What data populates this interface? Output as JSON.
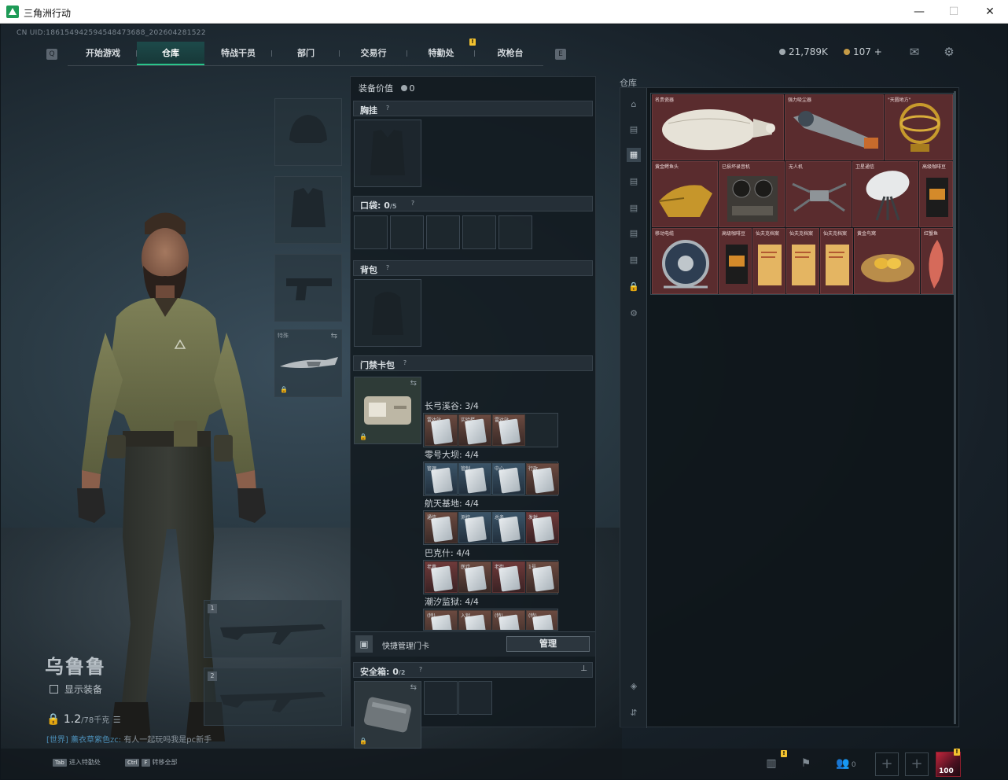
{
  "window": {
    "title": "三角洲行动",
    "minimize": "—",
    "maximize": "☐",
    "close": "✕"
  },
  "account": {
    "cnuid": "CN UID:18615494259454847368​8_202604281522"
  },
  "nav": {
    "left_key": "Q",
    "right_key": "E",
    "tabs": [
      {
        "label": "开始游戏"
      },
      {
        "label": "仓库"
      },
      {
        "label": "特战干员"
      },
      {
        "label": "部门"
      },
      {
        "label": "交易行"
      },
      {
        "label": "特勤处"
      },
      {
        "label": "改枪台"
      }
    ],
    "badge": "!"
  },
  "currency": {
    "silver": "21,789K",
    "gold": "107",
    "add": "+"
  },
  "character": {
    "name": "乌鲁鲁",
    "show_equipment": "显示装备",
    "weight": "1.2",
    "weight_max": "/78千克"
  },
  "chat": {
    "channel": "[世界]",
    "user": "薰衣草紫色zc:",
    "message": "有人一起玩吗我是pc新手"
  },
  "equipment": {
    "melee_label": "特殊",
    "slot1": "1",
    "slot2": "2"
  },
  "loadout": {
    "value_label": "装备价值",
    "value": "0",
    "chest_rig": "胸挂",
    "pockets": "口袋:",
    "pockets_count": "0",
    "pockets_cap": "/5",
    "backpack": "背包",
    "keycard_case": "门禁卡包",
    "maps": [
      {
        "name": "长弓溪谷: 3/4",
        "cards": [
          "雷达站",
          "实验楼",
          "雷达站"
        ],
        "style": "brown"
      },
      {
        "name": "零号大坝: 4/4",
        "cards": [
          "管理",
          "管制",
          "中心",
          "行政"
        ],
        "style": "mixed"
      },
      {
        "name": "航天基地: 4/4",
        "cards": [
          "通信",
          "测控",
          "总务",
          "发射"
        ],
        "style": "mixed2"
      },
      {
        "name": "巴克什: 4/4",
        "cards": [
          "老巷",
          "医疗",
          "老街",
          "1号"
        ],
        "style": "brown"
      },
      {
        "name": "潮汐监狱: 4/4",
        "cards": [
          "(特)",
          "入狱",
          "(特)",
          "(特)"
        ],
        "style": "brown"
      }
    ],
    "quick_manage": "快捷管理门卡",
    "manage_button": "管理",
    "safe_box": "安全箱:",
    "safe_count": "0",
    "safe_cap": "/2",
    "help": "?",
    "pin": "⊥"
  },
  "storage": {
    "title": "仓库",
    "items": [
      {
        "name": "名贵瓷器",
        "glyph": "⚱"
      },
      {
        "name": "强力吸尘器",
        "glyph": "🔧"
      },
      {
        "name": "\"天圆地方\"",
        "glyph": "☼"
      },
      {
        "name": "黄金鳄鱼头",
        "glyph": "🐊"
      },
      {
        "name": "已损坏录音机",
        "glyph": "⊙⊙"
      },
      {
        "name": "无人机",
        "glyph": "✈"
      },
      {
        "name": "卫星通信",
        "glyph": "◐"
      },
      {
        "name": "高级咖啡豆",
        "glyph": "▮"
      },
      {
        "name": "移动电缆",
        "glyph": "◎"
      },
      {
        "name": "高级咖啡豆",
        "glyph": "▮"
      },
      {
        "name": "仙夫克档案",
        "glyph": "▤"
      },
      {
        "name": "仙夫克档案",
        "glyph": "▤"
      },
      {
        "name": "仙夫克档案",
        "glyph": "▤"
      },
      {
        "name": "黄金鸟窝",
        "glyph": "◍"
      },
      {
        "name": "红蟹鱼",
        "glyph": "🐟"
      }
    ]
  },
  "bottom": {
    "tab_key": "Tab",
    "tab_hint": "进入特勤处",
    "ctrl_key": "Ctrl",
    "f_key": "F",
    "ctrl_hint": "转移全部",
    "team_count": "0",
    "avatar_level": "100"
  }
}
